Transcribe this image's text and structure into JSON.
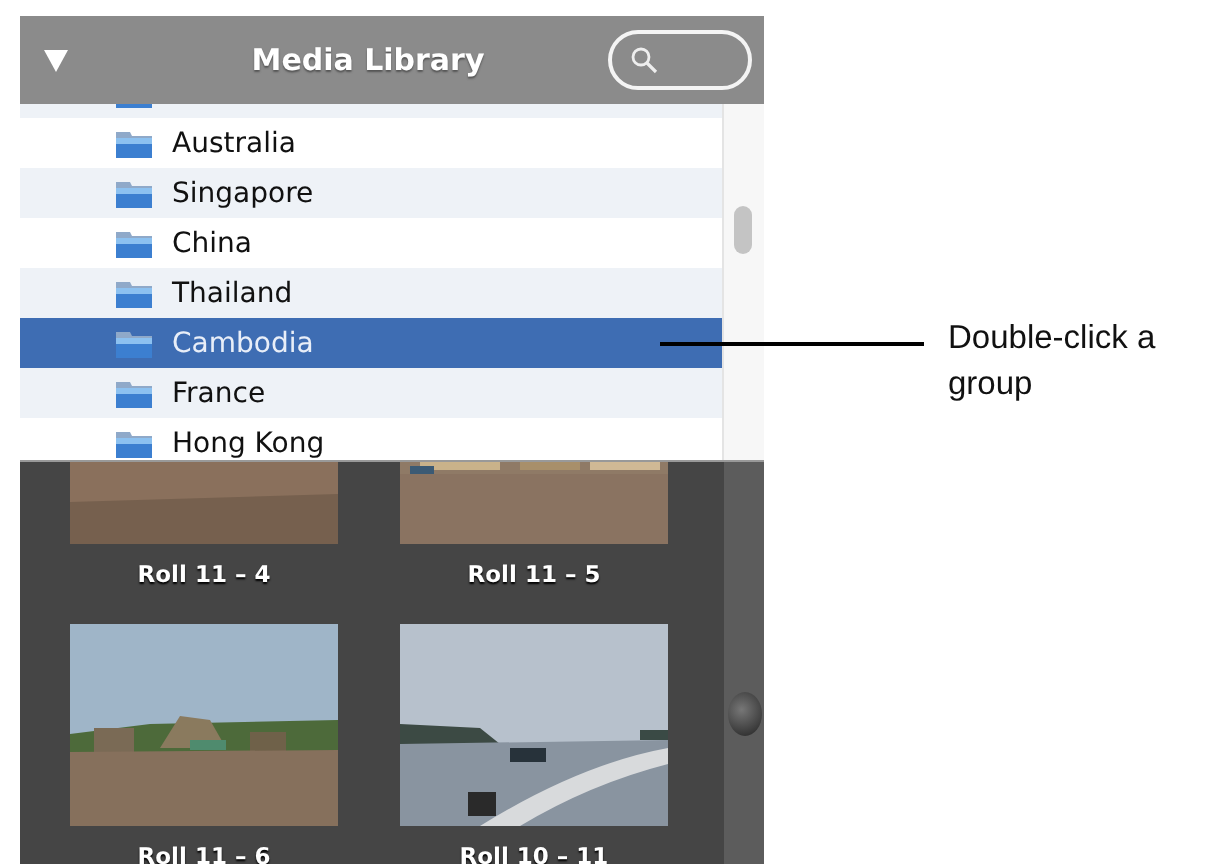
{
  "header": {
    "title": "Media Library"
  },
  "groups": [
    {
      "label": "Australia",
      "selected": false
    },
    {
      "label": "Singapore",
      "selected": false
    },
    {
      "label": "China",
      "selected": false
    },
    {
      "label": "Thailand",
      "selected": false
    },
    {
      "label": "Cambodia",
      "selected": true
    },
    {
      "label": "France",
      "selected": false
    },
    {
      "label": "Hong Kong",
      "selected": false
    }
  ],
  "photos": [
    {
      "caption": "Roll 11 – 4"
    },
    {
      "caption": "Roll 11 – 5"
    },
    {
      "caption": "Roll 11 – 6"
    },
    {
      "caption": "Roll 10 – 11"
    }
  ],
  "callout": {
    "text": "Double-click a group"
  }
}
